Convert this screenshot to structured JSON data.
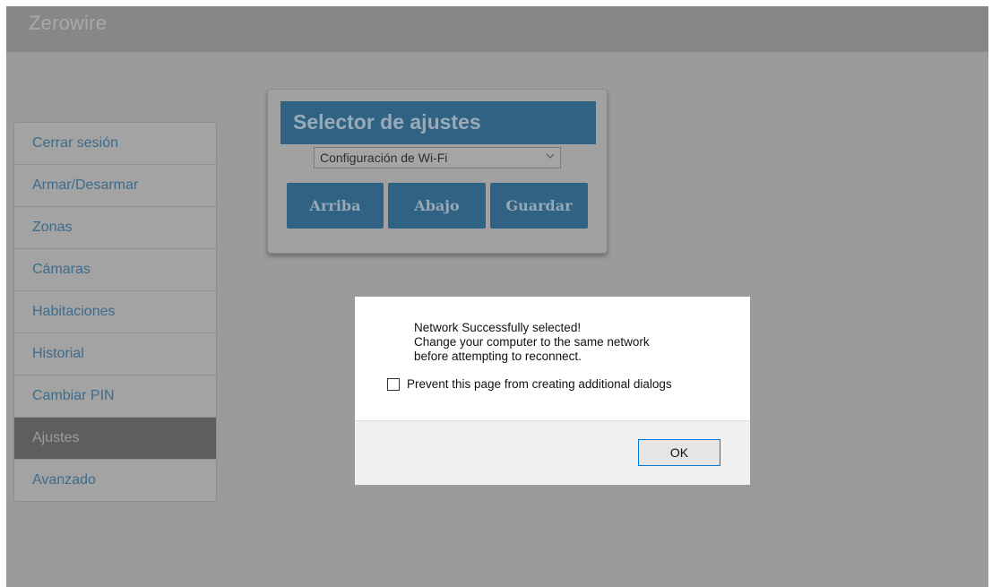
{
  "app": {
    "brand": "Zerowire"
  },
  "sidebar": {
    "items": [
      {
        "label": "Cerrar sesión"
      },
      {
        "label": "Armar/Desarmar"
      },
      {
        "label": "Zonas"
      },
      {
        "label": "Cámaras"
      },
      {
        "label": "Habitaciones"
      },
      {
        "label": "Historial"
      },
      {
        "label": "Cambiar PIN"
      },
      {
        "label": "Ajustes",
        "active": true
      },
      {
        "label": "Avanzado"
      }
    ]
  },
  "settings_panel": {
    "title": "Selector de ajustes",
    "select": {
      "value": "Configuración de Wi-Fi"
    },
    "buttons": {
      "up": "Arriba",
      "down": "Abajo",
      "save": "Guardar"
    }
  },
  "dialog": {
    "message_lines": [
      "Network Successfully selected!",
      "Change your computer to the same network",
      "before attempting to reconnect."
    ],
    "checkbox_label": "Prevent this page from creating additional dialogs",
    "ok_label": "OK"
  },
  "colors": {
    "accent": "#2f6283",
    "link": "#3d6c8c",
    "overlay_bg": "#9b9b9b",
    "active_item": "#5e5e5e"
  }
}
